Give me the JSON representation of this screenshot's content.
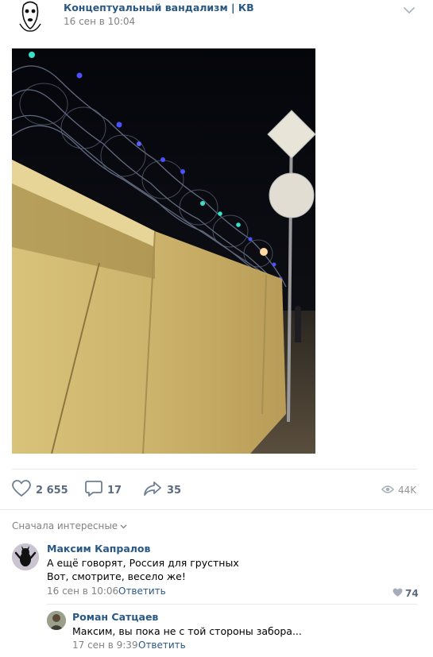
{
  "post": {
    "author": "Концептуальный вандализм | КВ",
    "date": "16 сен в 10:04",
    "image_description_icon": "photo-night-fence"
  },
  "actions": {
    "likes": "2 655",
    "comments": "17",
    "shares": "35",
    "views": "44K"
  },
  "comments_sort": "Сначала интересные",
  "comments": [
    {
      "author": "Максим Капралов",
      "lines": [
        "А ещё говорят, Россия для грустных",
        "Вот, смотрите, весело же!"
      ],
      "date": "16 сен в 10:06",
      "reply_label": "Ответить",
      "likes": "74"
    },
    {
      "author": "Роман Сатцаев",
      "text": "Максим, вы пока не с той стороны забора...",
      "date": "17 сен в 9:39",
      "reply_label": "Ответить"
    }
  ],
  "colors": {
    "link": "#2a5885",
    "muted": "#828282",
    "action": "#5c6b7f",
    "divider": "#e7e8ec"
  }
}
